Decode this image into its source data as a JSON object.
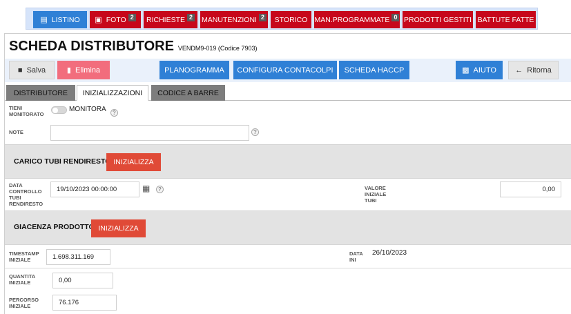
{
  "topnav": {
    "listino": "LISTINO",
    "foto": "FOTO",
    "foto_badge": "2",
    "richieste": "RICHIESTE",
    "richieste_badge": "2",
    "manutenzioni": "MANUTENZIONI",
    "manutenzioni_badge": "2",
    "storico": "STORICO",
    "man_programmate": "MAN.PROGRAMMATE",
    "man_programmate_badge": "0",
    "prodotti_gestiti": "PRODOTTI GESTITI",
    "battute_fatte": "BATTUTE FATTE"
  },
  "header": {
    "title": "SCHEDA DISTRIBUTORE",
    "subtitle": "VENDM9-019 (Codice 7903)"
  },
  "toolbar": {
    "save": "Salva",
    "delete": "Elimina",
    "planogramma": "PLANOGRAMMA",
    "configura_contacolpi": "CONFIGURA CONTACOLPI",
    "scheda_haccp": "SCHEDA HACCP",
    "aiuto": "AIUTO",
    "ritorna": "Ritorna"
  },
  "tabs": [
    "DISTRIBUTORE",
    "INIZIALIZZAZIONI",
    "CODICE A BARRE"
  ],
  "form": {
    "tieni_monitorato_label1": "TIENI",
    "tieni_monitorato_label2": "MONITORATO",
    "monitora_text": "MONITORA",
    "note_label": "NOTE",
    "note_value": "",
    "carico_title": "CARICO TUBI RENDIRESTO",
    "inizializza": "INIZIALIZZA",
    "data_controllo_l1": "DATA",
    "data_controllo_l2": "CONTROLLO",
    "data_controllo_l3": "TUBI",
    "data_controllo_l4": "RENDIRESTO",
    "data_controllo_value": "19/10/2023 00:00:00",
    "valore_iniziale_l1": "VALORE",
    "valore_iniziale_l2": "INIZIALE",
    "valore_iniziale_l3": "TUBI",
    "valore_iniziale_value": "0,00",
    "giacenza_title": "GIACENZA PRODOTTO",
    "timestamp_l1": "TIMESTAMP",
    "timestamp_l2": "INIZIALE",
    "timestamp_value": "1.698.311.169",
    "data_ini_l1": "DATA",
    "data_ini_l2": "INI",
    "data_ini_value": "26/10/2023",
    "quantita_l1": "QUANTITA",
    "quantita_l2": "INIZIALE",
    "quantita_value": "0,00",
    "percorso_l1": "PERCORSO",
    "percorso_l2": "INIZIALE",
    "percorso_value": "76.176"
  },
  "colors": {
    "nav_blue": "#2f80d6",
    "nav_red": "#c7071b",
    "delete_pink": "#f26d7d",
    "action_red": "#e04a37"
  }
}
